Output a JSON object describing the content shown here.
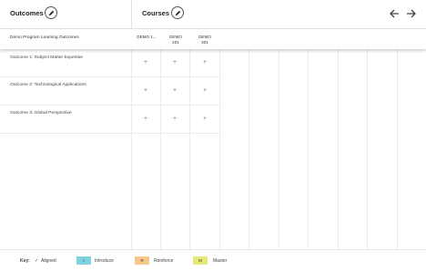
{
  "header": {
    "outcomes_title": "Outcomes",
    "courses_title": "Courses",
    "edit_icon": "pencil-icon",
    "nav": {
      "prev_icon": "arrow-left-icon",
      "next_icon": "arrow-right-icon"
    }
  },
  "subheader": {
    "program_label": "Demo Program Learning Outcomes",
    "courses": [
      {
        "line1": "DEMO 1...",
        "line2": ""
      },
      {
        "line1": "DEMO",
        "line2": "201"
      },
      {
        "line1": "DEMO",
        "line2": "301"
      }
    ]
  },
  "outcomes": [
    {
      "label": "Outcome 1: Subject Matter Expertise",
      "cells": [
        "+",
        "+",
        "+"
      ]
    },
    {
      "label": "Outcome 2: Technological Applications",
      "cells": [
        "+",
        "+",
        "+"
      ]
    },
    {
      "label": "Outcome 3: Global Perspective",
      "cells": [
        "+",
        "+",
        "+"
      ]
    }
  ],
  "legend": {
    "key_label": "Key:",
    "aligned": {
      "symbol": "✓",
      "label": "Aligned"
    },
    "introduce": {
      "code": "I",
      "label": "Introduce",
      "color": "#7fd3dc"
    },
    "reinforce": {
      "code": "R",
      "label": "Reinforce",
      "color": "#f7c98b"
    },
    "master": {
      "code": "M",
      "label": "Master",
      "color": "#e6e87a"
    }
  }
}
